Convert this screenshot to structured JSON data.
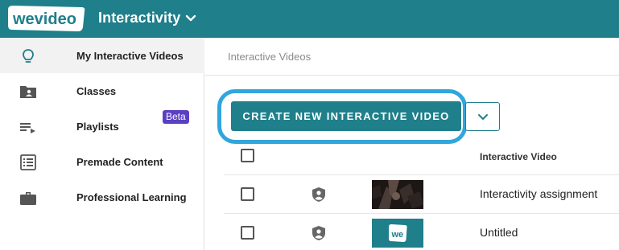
{
  "header": {
    "logo_text": "wevideo",
    "workspace_title": "Interactivity",
    "workspace_menu_icon": "chevron-down-icon",
    "background_color": "#1f7f8a"
  },
  "sidebar": {
    "items": [
      {
        "label": "My Interactive Videos",
        "icon": "lightbulb-icon",
        "active": true
      },
      {
        "label": "Classes",
        "icon": "folder-user-icon"
      },
      {
        "label": "Playlists",
        "icon": "playlist-icon"
      },
      {
        "label": "Premade Content",
        "icon": "list-box-icon",
        "badge": "Beta"
      },
      {
        "label": "Professional Learning",
        "icon": "briefcase-icon"
      }
    ]
  },
  "breadcrumb": {
    "text": "Interactive Videos"
  },
  "toolbar": {
    "create_label": "CREATE NEW INTERACTIVE VIDEO",
    "dropdown_icon": "chevron-down-icon",
    "highlight_color": "#31a6dc"
  },
  "table": {
    "columns": [
      "Interactive Video"
    ],
    "rows": [
      {
        "title": "Interactivity assignment",
        "icon": "shield-user-icon",
        "thumbnail": "dark-video-thumbnail"
      },
      {
        "title": "Untitled",
        "icon": "shield-user-icon",
        "thumbnail": "we-logo-thumbnail",
        "thumbnail_text": "we"
      }
    ]
  },
  "colors": {
    "accent": "#1f7f8a",
    "beta_badge": "#5b3fc4"
  }
}
